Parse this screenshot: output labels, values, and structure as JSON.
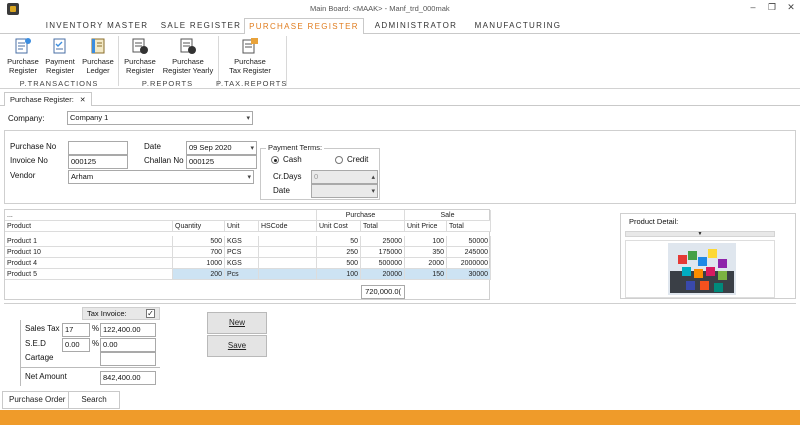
{
  "window": {
    "title": "Main Board: <MAAK> - Manf_trd_000mak",
    "minimize": "–",
    "restore": "❐",
    "close": "✕"
  },
  "ribbon_tabs": [
    "INVENTORY MASTER",
    "SALE REGISTER",
    "PURCHASE REGISTER",
    "ADMINISTRATOR",
    "MANUFACTURING"
  ],
  "active_tab": "PURCHASE REGISTER",
  "ribbon_groups": [
    {
      "label": "P.TRANSACTIONS",
      "buttons": [
        {
          "line1": "Purchase",
          "line2": "Register",
          "icon": "purchase-register-icon"
        },
        {
          "line1": "Payment",
          "line2": "Register",
          "icon": "payment-register-icon"
        },
        {
          "line1": "Purchase",
          "line2": "Ledger",
          "icon": "ledger-icon"
        }
      ]
    },
    {
      "label": "P.REPORTS",
      "buttons": [
        {
          "line1": "Purchase",
          "line2": "Register",
          "icon": "report-icon"
        },
        {
          "line1": "Purchase",
          "line2": "Register Yearly",
          "icon": "yearly-report-icon"
        }
      ]
    },
    {
      "label": "P.TAX.REPORTS",
      "buttons": [
        {
          "line1": "Purchase",
          "line2": "Tax Register",
          "icon": "tax-register-icon"
        }
      ]
    }
  ],
  "doc_tab": {
    "label": "Purchase Register:",
    "close": "✕"
  },
  "company": {
    "label": "Company:",
    "value": "Company 1"
  },
  "form": {
    "purchase_no_label": "Purchase No",
    "purchase_no_value": "",
    "invoice_no_label": "Invoice No",
    "invoice_no_value": "000125",
    "vendor_label": "Vendor",
    "vendor_value": "Arham",
    "date_label": "Date",
    "date_value": "09 Sep 2020",
    "challan_no_label": "Challan No",
    "challan_no_value": "000125"
  },
  "payment_terms": {
    "legend": "Payment Terms:",
    "cash_label": "Cash",
    "credit_label": "Credit",
    "selected": "Cash",
    "crdays_label": "Cr.Days",
    "crdays_value": "0",
    "date_label": "Date",
    "date_value": ""
  },
  "grid": {
    "ellipsis": "...",
    "group_purchase": "Purchase",
    "group_sale": "Sale",
    "columns": [
      "Product",
      "Quantity",
      "Unit",
      "HSCode",
      "Unit Cost",
      "Total",
      "Unit Price",
      "Total"
    ],
    "rows": [
      [
        "Product 1",
        "500",
        "KGS",
        "",
        "50",
        "25000",
        "100",
        "50000"
      ],
      [
        "Product 10",
        "700",
        "PCS",
        "",
        "250",
        "175000",
        "350",
        "245000"
      ],
      [
        "Product 4",
        "1000",
        "KGS",
        "",
        "500",
        "500000",
        "2000",
        "2000000"
      ],
      [
        "Product 5",
        "200",
        "Pcs",
        "",
        "100",
        "20000",
        "150",
        "30000"
      ]
    ],
    "selected_row": 3,
    "grand_total": "720,000.0("
  },
  "product_detail": {
    "label": "Product Detail:",
    "dropdown_arrow": "▼"
  },
  "tax": {
    "tax_invoice_label": "Tax Invoice:",
    "tax_invoice_checked": "✓",
    "sales_tax_label": "Sales Tax",
    "sales_tax_pct": "17",
    "sales_tax_amount": "122,400.00",
    "sed_label": "S.E.D",
    "sed_pct": "0.00",
    "sed_amount": "0.00",
    "cartage_label": "Cartage",
    "cartage_value": "",
    "pct_sign": "%",
    "net_amount_label": "Net Amount",
    "net_amount_value": "842,400.00"
  },
  "buttons": {
    "new": "New",
    "save": "Save"
  },
  "bottom_tabs": [
    "Purchase Order",
    "Search"
  ],
  "colors": {
    "accent": "#e07d1f",
    "status_bar": "#ef9b2a",
    "selection": "#cde3f3"
  }
}
